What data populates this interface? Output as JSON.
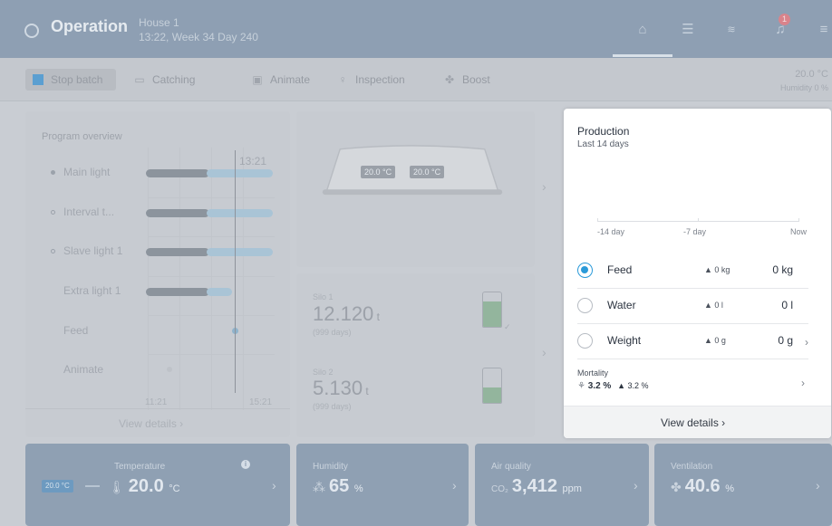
{
  "header": {
    "title": "Operation",
    "house": "House 1",
    "time_info": "13:22, Week 34 Day 240",
    "notification_count": "1"
  },
  "toolbar": {
    "stop_batch": "Stop batch",
    "catching": "Catching",
    "animate": "Animate",
    "inspection": "Inspection",
    "boost": "Boost",
    "outside_temp": "20.0 °C",
    "humidity": "Humidity 0 %"
  },
  "program": {
    "title": "Program overview",
    "rows": [
      "Main light",
      "Interval t...",
      "Slave light 1",
      "Extra light 1",
      "Feed",
      "Animate"
    ],
    "now_time": "13:21",
    "time_start": "11:21",
    "time_end": "15:21",
    "view_details": "View details"
  },
  "house": {
    "temp_left": "20.0 °C",
    "temp_right": "20.0 °C"
  },
  "silos": [
    {
      "label": "Silo 1",
      "value": "12.120",
      "unit": "t",
      "days": "(999 days)",
      "fill": 0.75
    },
    {
      "label": "Silo 2",
      "value": "5.130",
      "unit": "t",
      "days": "(999 days)",
      "fill": 0.45
    }
  ],
  "production": {
    "title": "Production",
    "subtitle": "Last 14 days",
    "axis": [
      "-14 day",
      "-7 day",
      "Now"
    ],
    "rows": [
      {
        "name": "Feed",
        "delta": "▲ 0 kg",
        "value": "0 kg",
        "selected": true
      },
      {
        "name": "Water",
        "delta": "▲ 0 l",
        "value": "0 l",
        "selected": false
      },
      {
        "name": "Weight",
        "delta": "▲ 0 g",
        "value": "0 g",
        "selected": false
      }
    ],
    "mortality_label": "Mortality",
    "mortality_value": "3.2 %",
    "mortality_delta": "▲ 3.2 %",
    "view_details": "View details"
  },
  "stats": {
    "temperature": {
      "label": "Temperature",
      "value": "20.0",
      "unit": "°C",
      "chip": "20.0 °C"
    },
    "humidity": {
      "label": "Humidity",
      "value": "65",
      "unit": "%"
    },
    "air_quality": {
      "label": "Air quality",
      "prefix": "CO₂",
      "value": "3,412",
      "unit": "ppm"
    },
    "ventilation": {
      "label": "Ventilation",
      "value": "40.6",
      "unit": "%"
    }
  },
  "colors": {
    "accent": "#2a9ad9",
    "header": "#8e9fb3"
  }
}
